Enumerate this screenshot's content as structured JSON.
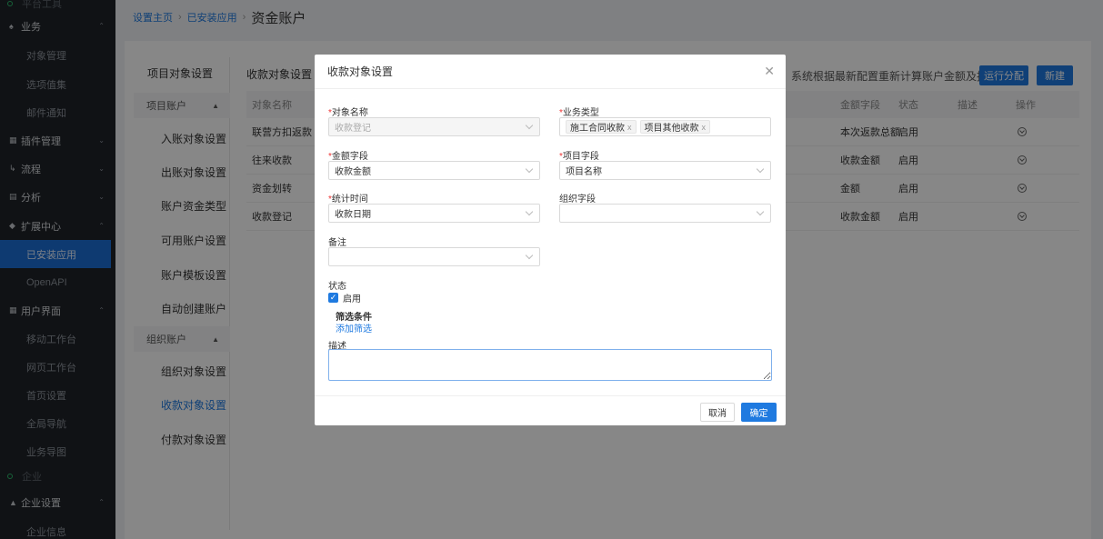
{
  "sidebar": {
    "top_cut": "平台工具",
    "groups": [
      {
        "label": "业务",
        "items": [
          "对象管理",
          "选项值集",
          "邮件通知"
        ]
      },
      {
        "label": "插件管理"
      },
      {
        "label": "流程"
      },
      {
        "label": "分析"
      },
      {
        "label": "扩展中心",
        "items": [
          "已安装应用",
          "OpenAPI"
        ]
      },
      {
        "label": "用户界面",
        "items": [
          "移动工作台",
          "网页工作台",
          "首页设置",
          "全局导航",
          "业务导图"
        ]
      }
    ],
    "section_enterprise": "企业",
    "enterprise_group": {
      "label": "企业设置",
      "items": [
        "企业信息"
      ]
    },
    "active_item": "已安装应用"
  },
  "breadcrumb": {
    "home": "设置主页",
    "installed": "已安装应用",
    "current": "资金账户"
  },
  "subnav": {
    "top": "项目对象设置",
    "group1": "项目账户",
    "group1_items": [
      "入账对象设置",
      "出账对象设置",
      "账户资金类型",
      "可用账户设置",
      "账户模板设置",
      "自动创建账户"
    ],
    "group2": "组织账户",
    "group2_items": [
      "组织对象设置",
      "收款对象设置",
      "付款对象设置"
    ],
    "active": "收款对象设置"
  },
  "content": {
    "title": "收款对象设置",
    "info": "系统根据最新配置重新计算账户金额及报表",
    "btn_recalc": "运行分配",
    "btn_new": "新建",
    "columns": [
      "对象名称",
      "金额字段",
      "状态",
      "描述",
      "操作"
    ],
    "rows": [
      {
        "name": "联营方扣返款",
        "amount": "本次返款总额",
        "status": "启用",
        "desc": ""
      },
      {
        "name": "往来收款",
        "amount": "收款金额",
        "status": "启用",
        "desc": ""
      },
      {
        "name": "资金划转",
        "amount": "金额",
        "status": "启用",
        "desc": ""
      },
      {
        "name": "收款登记",
        "amount": "收款金额",
        "status": "启用",
        "desc": ""
      }
    ]
  },
  "modal": {
    "title": "收款对象设置",
    "object_name": {
      "label": "对象名称",
      "value": "收款登记"
    },
    "business_type": {
      "label": "业务类型",
      "tags": [
        "施工合同收款",
        "项目其他收款"
      ]
    },
    "amount_field": {
      "label": "金额字段",
      "value": "收款金额"
    },
    "project_field": {
      "label": "项目字段",
      "value": "项目名称"
    },
    "stat_time": {
      "label": "统计时间",
      "value": "收款日期"
    },
    "org_field": {
      "label": "组织字段",
      "value": ""
    },
    "remark": {
      "label": "备注",
      "value": ""
    },
    "status": {
      "label": "状态",
      "checkbox_label": "启用",
      "checked": true
    },
    "filter": {
      "label": "筛选条件",
      "add_link": "添加筛选"
    },
    "description": {
      "label": "描述",
      "value": ""
    },
    "cancel": "取消",
    "confirm": "确定"
  },
  "colors": {
    "accent": "#1f7ae0",
    "sidebar_bg": "#1f2329",
    "required": "#e33333"
  }
}
